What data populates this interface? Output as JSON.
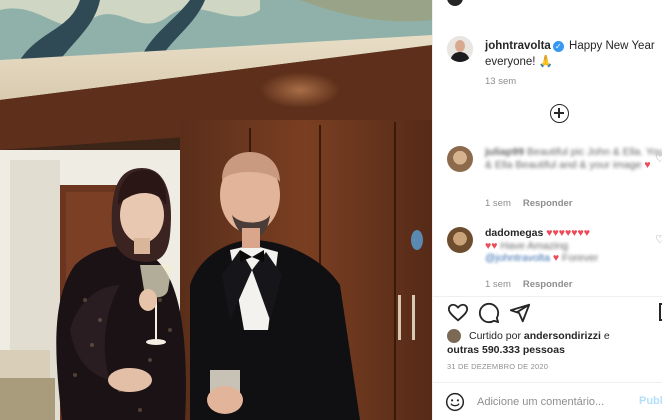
{
  "post": {
    "author": "johntravolta",
    "caption": "Happy New Year everyone!",
    "caption_emoji": "🙏",
    "caption_time": "13 sem"
  },
  "comments": [
    {
      "user": "juliap99",
      "text_blurred": "Beautiful pic John & Ella. You & Ella Beautiful and & your image",
      "time": "1 sem",
      "reply_label": "Responder"
    },
    {
      "user": "dadomegas",
      "hearts": "♥♥♥♥♥♥♥",
      "hearts_line2": "♥♥",
      "text": "Have Amazing",
      "mention_blurred": "@johntravolta",
      "tail_heart": "♥",
      "tail_text": "Forever",
      "time": "1 sem",
      "reply_label": "Responder"
    }
  ],
  "likes": {
    "prefix": "Curtido por",
    "user": "andersondirizzi",
    "conj": "e",
    "others": "outras 590.333 pessoas"
  },
  "date": "31 DE DEZEMBRO DE 2020",
  "add_comment": {
    "placeholder": "Adicione um comentário...",
    "post_label": "Publ"
  },
  "icons": {
    "verified": "✓"
  },
  "colors": {
    "verified_blue": "#3897f0",
    "heart_red": "#ed4956",
    "muted": "#8e8e8e",
    "post_button_disabled": "#b2dffc"
  }
}
